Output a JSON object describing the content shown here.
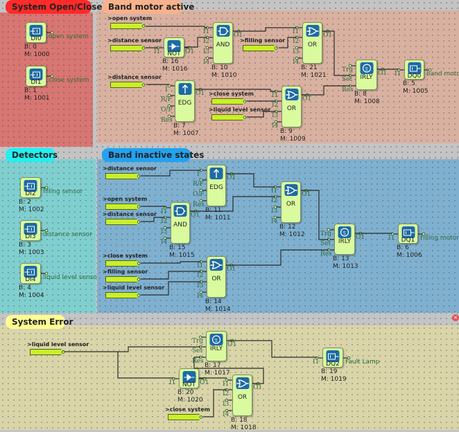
{
  "colors": {
    "tag_fill": "#c9ef2a",
    "block_fill": "#d9fb9e",
    "icon_blue": "#1d6aa5"
  },
  "groups": [
    {
      "title": "System Open/Close",
      "header_color": "#ff2a2a",
      "fill": "#d77672",
      "inputs": [],
      "blocks": [
        {
          "type": "DI0",
          "icon": "digital-input-icon",
          "b": "B: 0",
          "m": "M: 1000",
          "ports": [],
          "out": "open system"
        },
        {
          "type": "DI1",
          "icon": "digital-input-icon",
          "b": "B: 1",
          "m": "M: 1001",
          "ports": [],
          "out": "close system"
        }
      ]
    },
    {
      "title": "Band motor active",
      "header_color": "#f7b28c",
      "fill": "#d9b1a0",
      "inputs": [
        ">open system",
        ">distance sensor",
        ">distance sensor",
        ">filling sensor",
        ">close system",
        ">liquid level sensor"
      ],
      "blocks": [
        {
          "type": "NOT",
          "icon": "not-gate-icon",
          "b": "B: 16",
          "m": "M: 1016",
          "ports": [
            "I1"
          ],
          "o": "O1"
        },
        {
          "type": "AND",
          "icon": "and-gate-icon",
          "b": "B: 10",
          "m": "M: 1010",
          "ports": [
            "I1",
            "I2",
            "I3",
            "I4"
          ],
          "o": "O1"
        },
        {
          "type": "EDG",
          "icon": "edge-arrow-icon",
          "b": "B: 7",
          "m": "M: 1007",
          "ports": [
            "I",
            "R/F",
            "O/F",
            "Res"
          ],
          "o": "O1"
        },
        {
          "type": "OR",
          "icon": "or-gate-icon",
          "b": "B: 21",
          "m": "M: 1021",
          "ports": [
            "I1",
            "I2",
            "I3",
            "I4"
          ],
          "o": "O1"
        },
        {
          "type": "OR",
          "icon": "or-gate-icon",
          "b": "B: 9",
          "m": "M: 1009",
          "ports": [
            "I1",
            "I2",
            "I3",
            "I4"
          ],
          "o": "O1"
        },
        {
          "type": "IRLY",
          "icon": "relay-head-icon",
          "b": "B: 8",
          "m": "M: 1008",
          "ports": [
            "Trg",
            "Set",
            "Res"
          ],
          "o": "O1"
        },
        {
          "type": "DQ0",
          "icon": "digital-output-icon",
          "b": "B: 5",
          "m": "M: 1005",
          "ports": [
            "I1"
          ],
          "out": "band motor"
        }
      ]
    },
    {
      "title": "Detectors",
      "header_color": "#22f0f0",
      "fill": "#80cfcf",
      "inputs": [],
      "blocks": [
        {
          "type": "DI2",
          "icon": "digital-input-icon",
          "b": "B: 2",
          "m": "M: 1002",
          "ports": [],
          "out": "filling sensor"
        },
        {
          "type": "DI3",
          "icon": "digital-input-icon",
          "b": "B: 3",
          "m": "M: 1003",
          "ports": [],
          "out": "distance sensor"
        },
        {
          "type": "DI4",
          "icon": "digital-input-icon",
          "b": "B: 4",
          "m": "M: 1004",
          "ports": [],
          "out": "liquid level sensor"
        }
      ]
    },
    {
      "title": "Band inactive states",
      "header_color": "#22a2f0",
      "fill": "#7fb0cf",
      "inputs": [
        ">distance sensor",
        ">open system",
        ">distance sensor",
        ">close system",
        ">filling sensor",
        ">liquid level sensor"
      ],
      "blocks": [
        {
          "type": "EDG",
          "icon": "edge-arrow-icon",
          "b": "B: 11",
          "m": "M: 1011",
          "ports": [
            "I",
            "R/F",
            "O/F",
            "Res"
          ],
          "o": "O1"
        },
        {
          "type": "OR",
          "icon": "or-gate-icon",
          "b": "B: 12",
          "m": "M: 1012",
          "ports": [
            "I1",
            "I2",
            "I3",
            "I4"
          ],
          "o": "O1"
        },
        {
          "type": "AND",
          "icon": "and-gate-icon",
          "b": "B: 15",
          "m": "M: 1015",
          "ports": [
            "I1",
            "I2",
            "I3",
            "I4"
          ],
          "o": "O1"
        },
        {
          "type": "OR",
          "icon": "or-gate-icon",
          "b": "B: 14",
          "m": "M: 1014",
          "ports": [
            "I1",
            "I2",
            "I3",
            "I4"
          ],
          "o": "O1"
        },
        {
          "type": "IRLY",
          "icon": "relay-head-icon",
          "b": "B: 13",
          "m": "M: 1013",
          "ports": [
            "Trg",
            "Set",
            "Res"
          ],
          "o": "O1"
        },
        {
          "type": "DQ1",
          "icon": "digital-output-icon",
          "b": "B: 6",
          "m": "M: 1006",
          "ports": [
            "I1"
          ],
          "out": "Filling motor"
        }
      ]
    },
    {
      "title": "System Error",
      "header_color": "#fdfc92",
      "fill": "#d9d5a9",
      "inputs": [
        ">liquid level sensor",
        ">close system"
      ],
      "blocks": [
        {
          "type": "IRLY",
          "icon": "relay-head-icon",
          "b": "B: 17",
          "m": "M: 1017",
          "ports": [
            "Trg",
            "Set",
            "Res"
          ],
          "o": "O1"
        },
        {
          "type": "NOT",
          "icon": "not-gate-icon",
          "b": "B: 20",
          "m": "M: 1020",
          "ports": [
            "I1"
          ],
          "o": "O1"
        },
        {
          "type": "OR",
          "icon": "or-gate-icon",
          "b": "B: 18",
          "m": "M: 1018",
          "ports": [
            "I1",
            "I2",
            "I3",
            "I4"
          ],
          "o": "O1"
        },
        {
          "type": "DQ2",
          "icon": "digital-output-icon",
          "b": "B: 19",
          "m": "M: 1019",
          "ports": [
            "I1"
          ],
          "out": "Fault Lamp"
        }
      ]
    }
  ],
  "close_icon": "×"
}
